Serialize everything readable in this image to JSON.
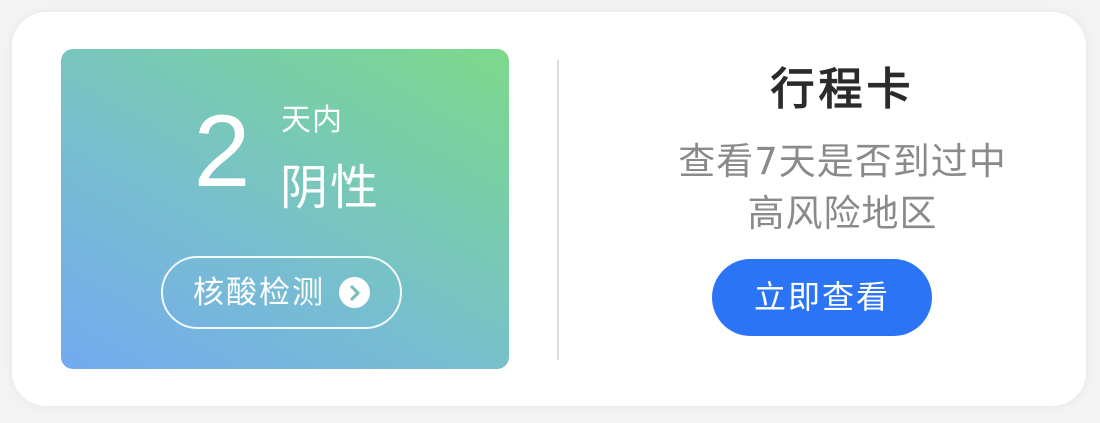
{
  "nat_card": {
    "days_number": "2",
    "days_unit": "天内",
    "result": "阴性",
    "button_label": "核酸检测",
    "gradient_colors": [
      "#74a9f0",
      "#77bed0",
      "#78cfa6",
      "#7dd98a"
    ]
  },
  "trip_card": {
    "title": "行程卡",
    "description_line1": "查看7天是否到过中",
    "description_line2": "高风险地区",
    "button_label": "立即查看",
    "button_color": "#2b74f5"
  },
  "icons": {
    "chevron": "chevron-right-icon"
  }
}
